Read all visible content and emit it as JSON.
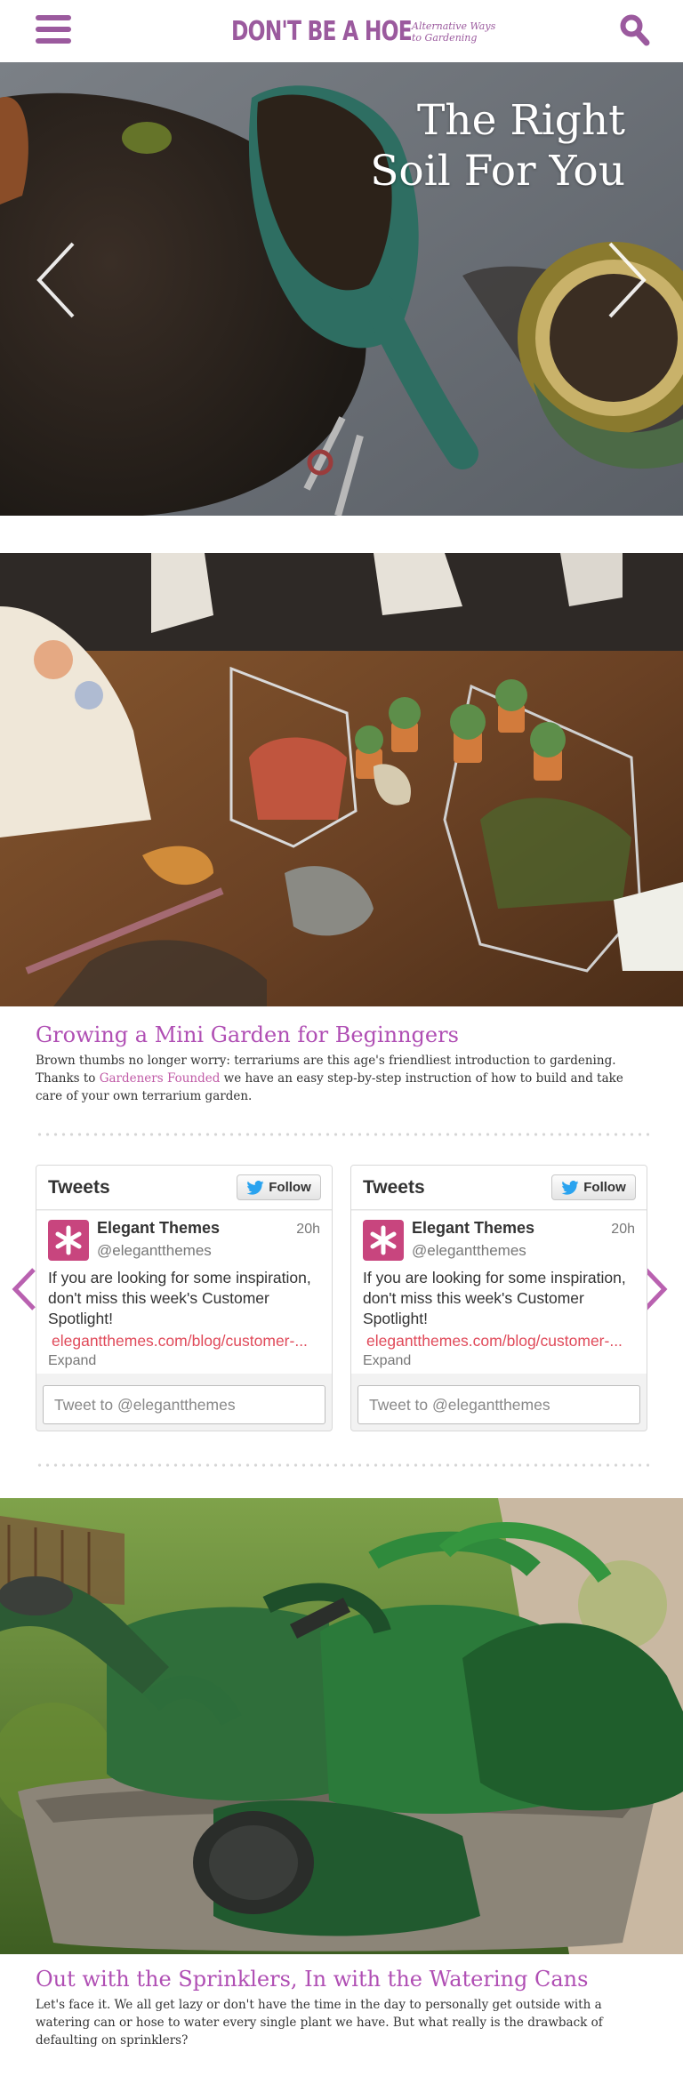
{
  "header": {
    "logo_main": "DON'T BE A HOE",
    "logo_tagline_line1": "Alternative Ways",
    "logo_tagline_line2": "to Gardening",
    "menu_icon": "hamburger-menu-icon",
    "search_icon": "search-icon"
  },
  "hero": {
    "title_line1": "The Right",
    "title_line2": "Soil For You",
    "prev_icon": "chevron-left-icon",
    "next_icon": "chevron-right-icon"
  },
  "articles": [
    {
      "title": "Growing a Mini Garden for Beginngers",
      "text_before_link": "Brown thumbs no longer worry: terrariums are this age's friendliest introduction to gardening. Thanks to ",
      "link_text": "Gardeners Founded",
      "text_after_link": " we have an easy step-by-step instruction of how to build and take care of your own terrarium garden."
    },
    {
      "title": "Out with the Sprinklers, In with the Watering Cans",
      "text": "Let's face it. We all get lazy or don't have the time in the day to personally get outside with a watering can or hose to water every single plant we have. But what really is the drawback of defaulting on sprinklers?"
    }
  ],
  "tweets": [
    {
      "heading": "Tweets",
      "follow_label": "Follow",
      "name": "Elegant Themes",
      "handle": "@elegantthemes",
      "time": "20h",
      "text": "If you are looking for some inspiration, don't miss this week's Customer Spotlight!",
      "link": "elegantthemes.com/blog/customer-...",
      "expand": "Expand",
      "input_placeholder": "Tweet to @elegantthemes"
    },
    {
      "heading": "Tweets",
      "follow_label": "Follow",
      "name": "Elegant Themes",
      "handle": "@elegantthemes",
      "time": "20h",
      "text": "If you are looking for some inspiration, don't miss this week's Customer Spotlight!",
      "link": "elegantthemes.com/blog/customer-...",
      "expand": "Expand",
      "input_placeholder": "Tweet to @elegantthemes"
    }
  ],
  "colors": {
    "brand_purple": "#9b5a9e",
    "title_purple": "#b04fb4",
    "link_pink": "#c05aa6",
    "tweet_link_red": "#e04a5a",
    "avatar_pink": "#c8457e"
  }
}
